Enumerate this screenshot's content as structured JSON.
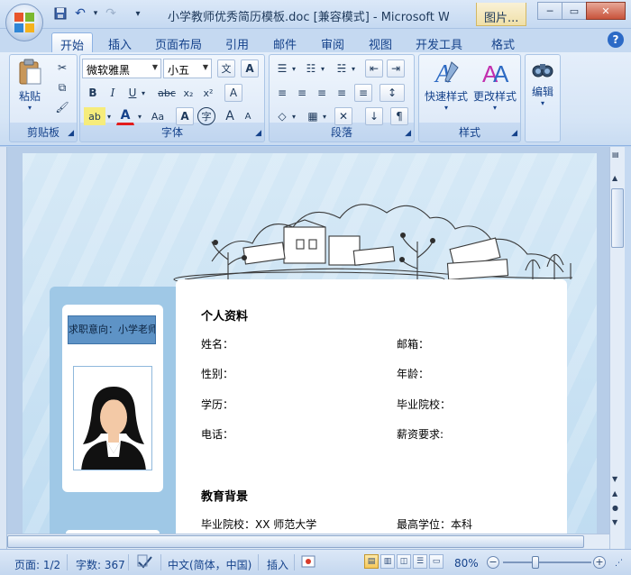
{
  "window": {
    "title": "小学教师优秀简历模板.doc [兼容模式] - Microsoft Wo...",
    "contextual_tab": "图片...",
    "minimize_glyph": "─",
    "maximize_glyph": "▭",
    "close_glyph": "✕"
  },
  "quick_access": {
    "save_glyph": "💾",
    "undo_glyph": "↶",
    "redo_glyph": "↷",
    "customize_glyph": "▾"
  },
  "tabs": [
    {
      "label": "开始",
      "active": true
    },
    {
      "label": "插入"
    },
    {
      "label": "页面布局"
    },
    {
      "label": "引用"
    },
    {
      "label": "邮件"
    },
    {
      "label": "审阅"
    },
    {
      "label": "视图"
    },
    {
      "label": "开发工具"
    },
    {
      "label": "格式"
    }
  ],
  "help_glyph": "?",
  "ribbon": {
    "clipboard": {
      "label": "剪贴板",
      "paste": "粘贴",
      "paste_arrow": "▾",
      "cut_glyph": "✂",
      "copy_glyph": "⧉",
      "painter_glyph": "🖌"
    },
    "font": {
      "label": "字体",
      "font_name": "微软雅黑",
      "font_size": "小五",
      "grow_glyph": "A",
      "shrink_glyph": "A",
      "bold": "B",
      "italic": "I",
      "underline": "U",
      "strike": "abc",
      "subscript": "x₂",
      "superscript": "x²",
      "clear_glyph": "A",
      "highlight_glyph": "ab",
      "color_glyph": "A",
      "case_glyph": "Aa",
      "border_glyph": "A",
      "circle_glyph": "字",
      "font_color": "#e21c1c",
      "phonetic_glyph": "文"
    },
    "paragraph": {
      "label": "段落",
      "bullets_glyph": "☰",
      "numbering_glyph": "☷",
      "multilevel_glyph": "☵",
      "decrease_indent_glyph": "⇤",
      "increase_indent_glyph": "⇥",
      "align_left": "≡",
      "center": "≡",
      "align_right": "≡",
      "justify": "≡",
      "distributed": "≡",
      "line_spacing_glyph": "↕",
      "shading_glyph": "◇",
      "borders_glyph": "▦",
      "chinese_layout_glyph": "✕",
      "sort_glyph": "↓",
      "show_marks_glyph": "¶"
    },
    "styles": {
      "label": "样式",
      "quick": "快速样式",
      "change": "更改样式"
    },
    "editing": {
      "label": "编辑",
      "binoculars_glyph": "🔍"
    }
  },
  "resume": {
    "job_intent": "求职意向：小学老师",
    "section_personal": "个人资料",
    "fields": {
      "name": "姓名：",
      "email": "邮箱：",
      "gender": "性别：",
      "age": "年龄：",
      "degree": "学历：",
      "school": "毕业院校：",
      "phone": "电话：",
      "salary": "薪资要求:"
    },
    "section_edu": "教育背景",
    "edu": {
      "school": "毕业院校：XX 师范大学",
      "top_degree": "最高学位：本科"
    }
  },
  "status_bar": {
    "page": "页面: 1/2",
    "words": "字数: 367",
    "language": "中文(简体，中国)",
    "insert": "插入",
    "zoom": "80%",
    "zoom_out": "−",
    "zoom_in": "+"
  }
}
